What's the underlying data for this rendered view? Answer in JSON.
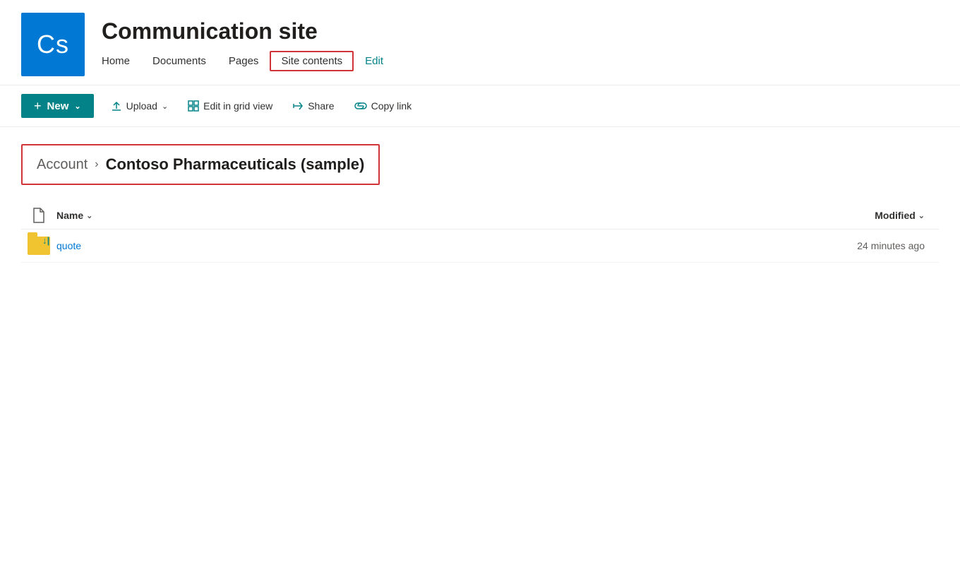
{
  "header": {
    "logo_text": "Cs",
    "site_title": "Communication site",
    "nav": {
      "home": "Home",
      "documents": "Documents",
      "pages": "Pages",
      "site_contents": "Site contents",
      "edit": "Edit"
    }
  },
  "toolbar": {
    "new_label": "New",
    "upload_label": "Upload",
    "edit_grid_label": "Edit in grid view",
    "share_label": "Share",
    "copy_link_label": "Copy link"
  },
  "breadcrumb": {
    "account": "Account",
    "separator": ">",
    "current": "Contoso Pharmaceuticals (sample)"
  },
  "file_list": {
    "header": {
      "name_col": "Name",
      "modified_col": "Modified"
    },
    "items": [
      {
        "name": "quote",
        "type": "folder",
        "modified": "24 minutes ago",
        "syncing": true
      }
    ]
  },
  "colors": {
    "teal": "#038387",
    "logo_blue": "#0078d4",
    "red_border": "#d13438",
    "folder_yellow": "#f0c330"
  }
}
